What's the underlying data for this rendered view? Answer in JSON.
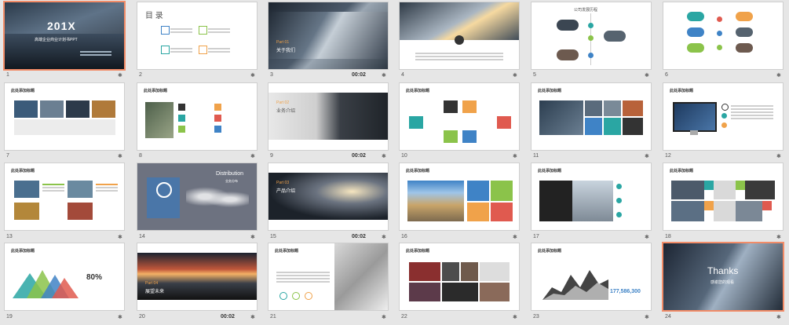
{
  "slides": [
    {
      "num": "1",
      "title": "201X",
      "subtitle": "高端企业商业计划书PPT"
    },
    {
      "num": "2",
      "title": "目 录"
    },
    {
      "num": "3",
      "part": "Part 01",
      "label": "关于我们",
      "duration": "00:02"
    },
    {
      "num": "4"
    },
    {
      "num": "5",
      "title": "公司发展历程"
    },
    {
      "num": "6"
    },
    {
      "num": "7",
      "head": "此处添加标题"
    },
    {
      "num": "8",
      "head": "此处添加标题"
    },
    {
      "num": "9",
      "part": "Part 02",
      "label": "业务介绍",
      "duration": "00:02"
    },
    {
      "num": "10",
      "head": "此处添加标题"
    },
    {
      "num": "11",
      "head": "此处添加标题"
    },
    {
      "num": "12",
      "head": "此处添加标题"
    },
    {
      "num": "13",
      "head": "此处添加标题"
    },
    {
      "num": "14",
      "title": "Distribution",
      "label": "业务分布"
    },
    {
      "num": "15",
      "part": "Part 03",
      "label": "产品介绍",
      "duration": "00:02"
    },
    {
      "num": "16",
      "head": "此处添加标题"
    },
    {
      "num": "17",
      "head": "此处添加标题"
    },
    {
      "num": "18",
      "head": "此处添加标题"
    },
    {
      "num": "19",
      "head": "此处添加标题",
      "stat": "80%"
    },
    {
      "num": "20",
      "part": "Part 04",
      "label": "展望未来",
      "duration": "00:02"
    },
    {
      "num": "21",
      "head": "此处添加标题"
    },
    {
      "num": "22",
      "head": "此处添加标题"
    },
    {
      "num": "23",
      "head": "此处添加标题",
      "stat": "177,586,300"
    },
    {
      "num": "24",
      "title": "Thanks",
      "label": "感谢您的观看"
    }
  ],
  "icons": {
    "transition": "star-icon"
  },
  "colors": {
    "selected": "#f28c68",
    "orange": "#f0a24a",
    "green": "#8bc34a",
    "blue": "#3f83c6",
    "red": "#e05a4f",
    "teal": "#2aa6a3"
  }
}
